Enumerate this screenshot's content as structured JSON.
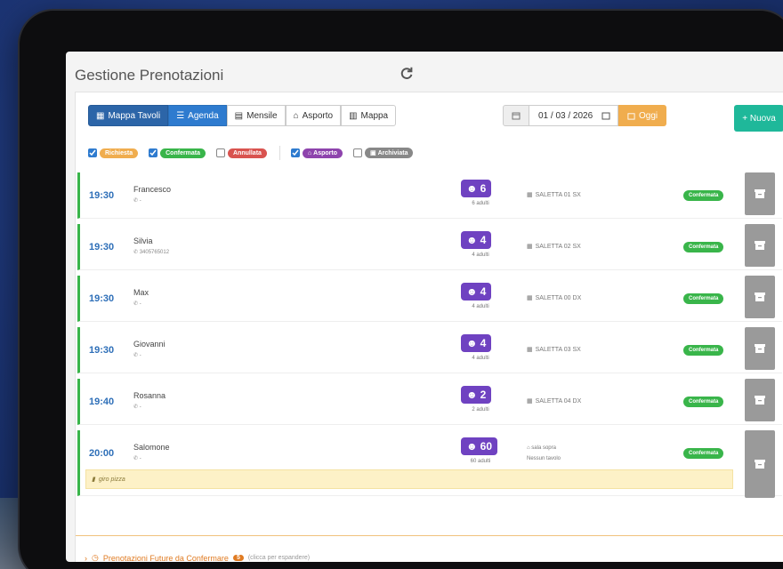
{
  "header": {
    "title": "Gestione Prenotazioni"
  },
  "view_buttons": [
    {
      "label": "Mappa Tavoli",
      "icon": "grid-icon"
    },
    {
      "label": "Agenda",
      "icon": "list-icon"
    },
    {
      "label": "Mensile",
      "icon": "calendar-icon"
    },
    {
      "label": "Asporto",
      "icon": "bag-icon"
    },
    {
      "label": "Mappa",
      "icon": "map-icon"
    }
  ],
  "date": {
    "value": "01 / 03 / 2026",
    "today_label": "Oggi"
  },
  "new_button": {
    "label": "+ Nuova"
  },
  "filters": [
    {
      "label": "Richiesta",
      "checked": true,
      "color": "#f0ad4e"
    },
    {
      "label": "Confermata",
      "checked": true,
      "color": "#39b54a"
    },
    {
      "label": "Annullata",
      "checked": false,
      "color": "#d9534f"
    },
    {
      "label": "Asporto",
      "checked": true,
      "color": "#8e44ad"
    },
    {
      "label": "Archiviata",
      "checked": false,
      "color": "#888888"
    }
  ],
  "reservations": [
    {
      "time": "19:30",
      "name": "Francesco",
      "phone": "-",
      "guests": "6",
      "guests_sub": "6 adulti",
      "table": "SALETTA 01 SX",
      "status": "Confermata"
    },
    {
      "time": "19:30",
      "name": "Silvia",
      "phone": "3405765012",
      "guests": "4",
      "guests_sub": "4 adulti",
      "table": "SALETTA 02 SX",
      "status": "Confermata"
    },
    {
      "time": "19:30",
      "name": "Max",
      "phone": "-",
      "guests": "4",
      "guests_sub": "4 adulti",
      "table": "SALETTA 00 DX",
      "status": "Confermata"
    },
    {
      "time": "19:30",
      "name": "Giovanni",
      "phone": "-",
      "guests": "4",
      "guests_sub": "4 adulti",
      "table": "SALETTA 03 SX",
      "status": "Confermata"
    },
    {
      "time": "19:40",
      "name": "Rosanna",
      "phone": "-",
      "guests": "2",
      "guests_sub": "2 adulti",
      "table": "SALETTA 04 DX",
      "status": "Confermata"
    },
    {
      "time": "20:00",
      "name": "Salomone",
      "phone": "-",
      "guests": "60",
      "guests_sub": "60 adulti",
      "table": "sala sopra",
      "table_sub": "Nessun tavolo",
      "status": "Confermata",
      "note": "giro pizza"
    }
  ],
  "footer": {
    "future_label": "Prenotazioni Future da Confermare",
    "future_count": "5",
    "future_hint": "(clicca per espandere)"
  }
}
